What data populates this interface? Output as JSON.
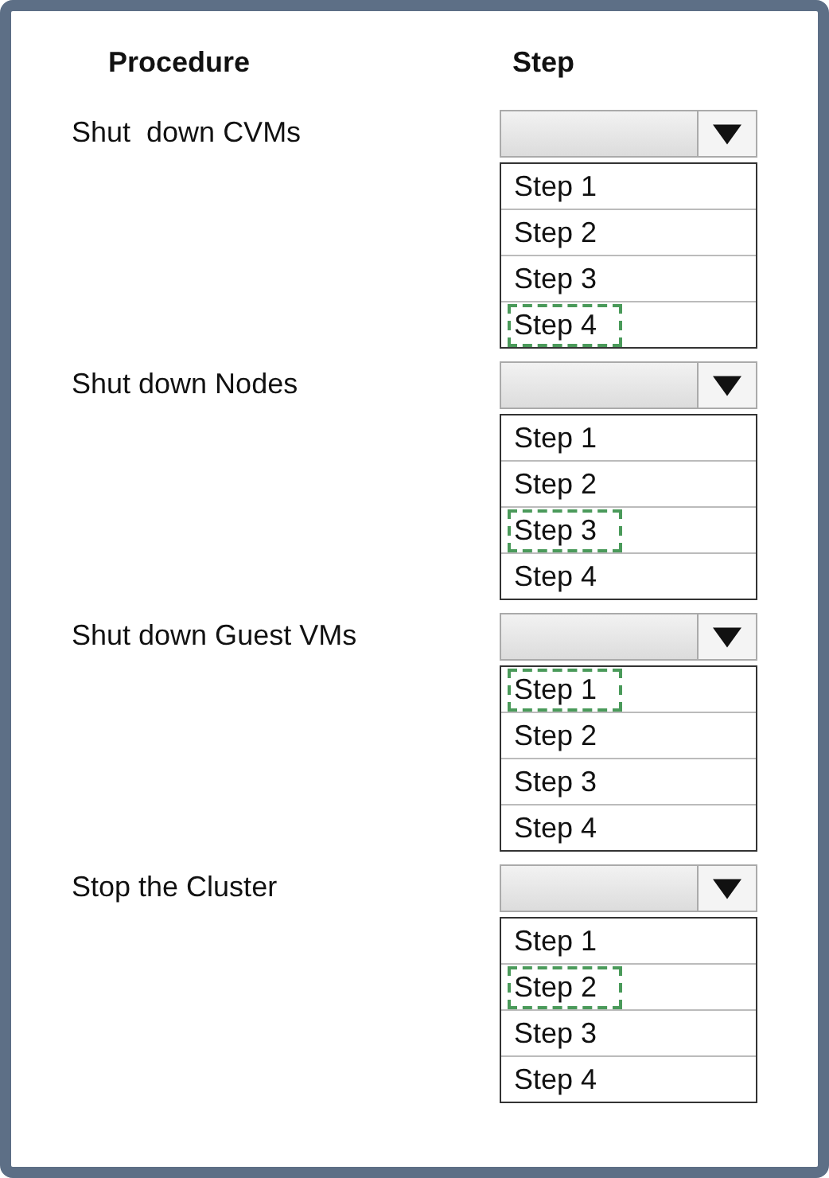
{
  "headers": [
    "Procedure",
    "Step"
  ],
  "rows": [
    {
      "procedure": "Shut  down CVMs",
      "options": [
        {
          "label": "Step 1",
          "selected": false
        },
        {
          "label": "Step 2",
          "selected": false
        },
        {
          "label": "Step 3",
          "selected": false
        },
        {
          "label": "Step 4",
          "selected": true
        }
      ]
    },
    {
      "procedure": "Shut down Nodes",
      "options": [
        {
          "label": "Step 1",
          "selected": false
        },
        {
          "label": "Step 2",
          "selected": false
        },
        {
          "label": "Step 3",
          "selected": true
        },
        {
          "label": "Step 4",
          "selected": false
        }
      ]
    },
    {
      "procedure": "Shut down Guest VMs",
      "options": [
        {
          "label": "Step 1",
          "selected": true
        },
        {
          "label": "Step 2",
          "selected": false
        },
        {
          "label": "Step 3",
          "selected": false
        },
        {
          "label": "Step 4",
          "selected": false
        }
      ]
    },
    {
      "procedure": "Stop the Cluster",
      "options": [
        {
          "label": "Step 1",
          "selected": false
        },
        {
          "label": "Step 2",
          "selected": true
        },
        {
          "label": "Step 3",
          "selected": false
        },
        {
          "label": "Step 4",
          "selected": false
        }
      ]
    }
  ]
}
